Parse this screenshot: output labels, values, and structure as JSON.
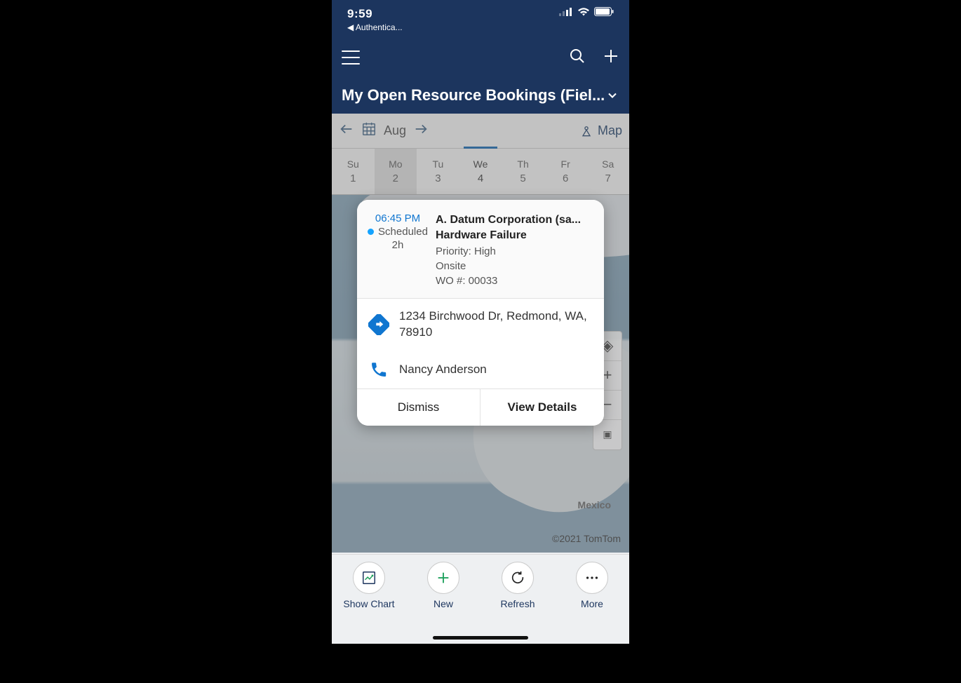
{
  "status": {
    "time": "9:59",
    "back_app": "◀ Authentica..."
  },
  "header": {
    "title": "My Open Resource Bookings (Fiel..."
  },
  "date_nav": {
    "month": "Aug",
    "map_label": "Map"
  },
  "week": {
    "days": [
      {
        "name": "Su",
        "num": "1"
      },
      {
        "name": "Mo",
        "num": "2"
      },
      {
        "name": "Tu",
        "num": "3"
      },
      {
        "name": "We",
        "num": "4"
      },
      {
        "name": "Th",
        "num": "5"
      },
      {
        "name": "Fr",
        "num": "6"
      },
      {
        "name": "Sa",
        "num": "7"
      }
    ],
    "highlighted_index": 1,
    "selected_index": 3
  },
  "card": {
    "time": "06:45 PM",
    "status": "Scheduled",
    "duration": "2h",
    "company": "A. Datum Corporation (sa...",
    "issue": "Hardware Failure",
    "priority": "Priority: High",
    "location_type": "Onsite",
    "wo": "WO #: 00033",
    "address": "1234 Birchwood Dr, Redmond, WA, 78910",
    "contact": "Nancy Anderson",
    "dismiss": "Dismiss",
    "view": "View Details"
  },
  "map": {
    "country_label": "Mexico",
    "credit": "©2021 TomTom"
  },
  "bottom": {
    "show_chart": "Show Chart",
    "new": "New",
    "refresh": "Refresh",
    "more": "More"
  }
}
